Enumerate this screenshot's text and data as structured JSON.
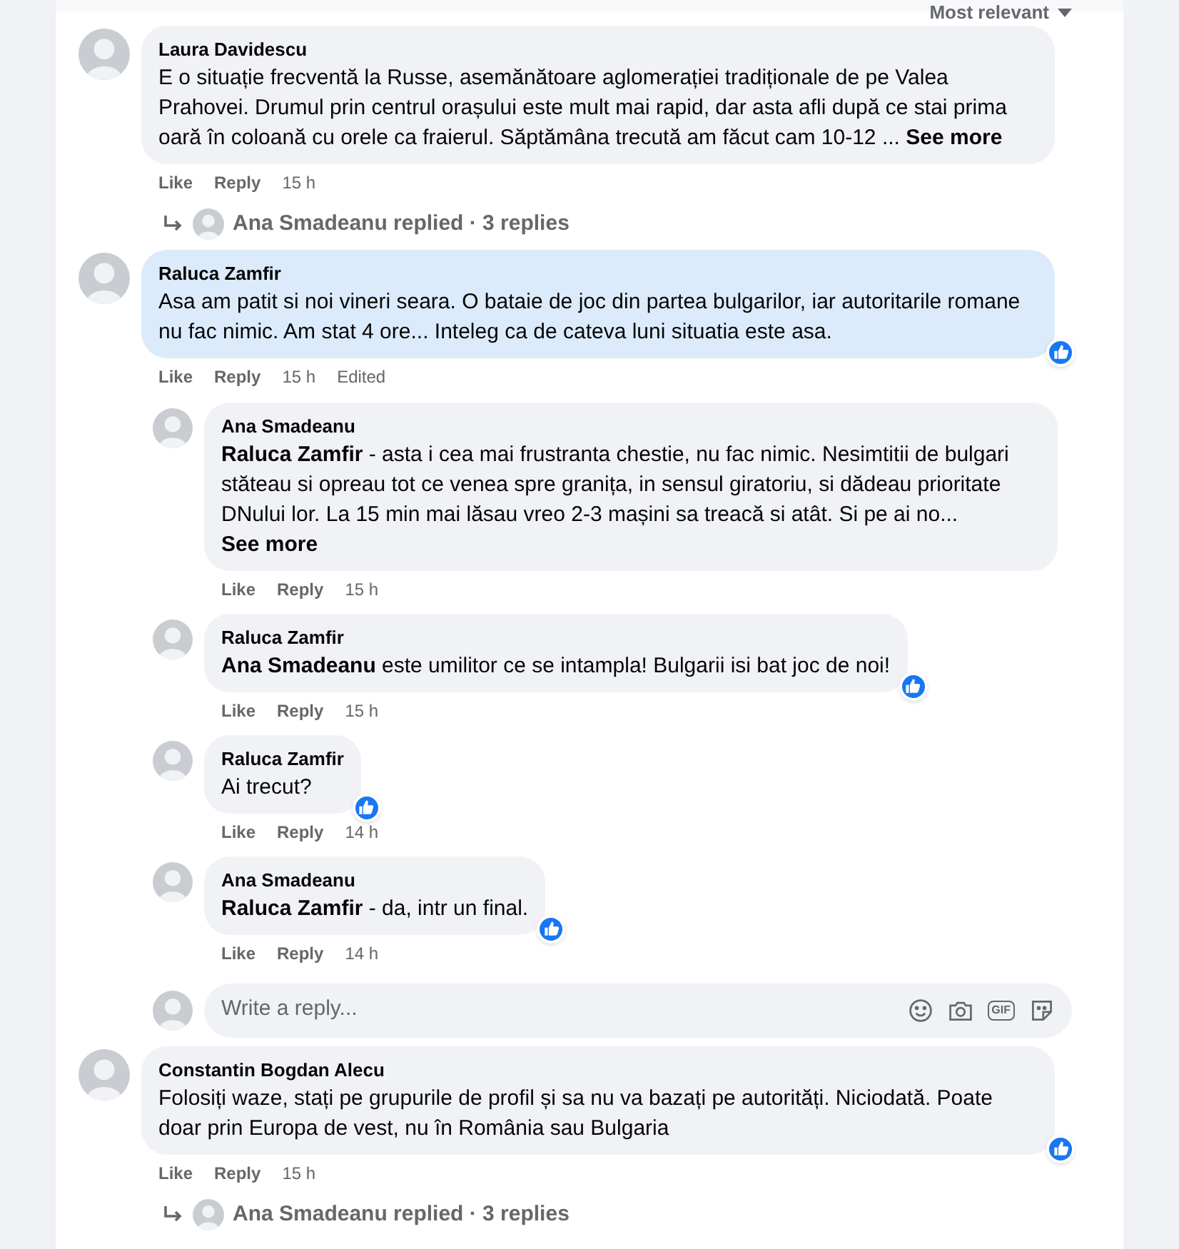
{
  "sort": {
    "label": "Most relevant"
  },
  "comments": [
    {
      "author": "Laura Davidescu",
      "text": "E o situație frecventă la Russe, asemănătoare aglomerației tradiționale de pe Valea Prahovei. Drumul prin centrul orașului este mult mai rapid, dar asta afli după ce stai prima oară în coloană cu orele ca fraierul. Săptămâna trecută am făcut cam 10-12 ...",
      "see_more": "See more",
      "highlighted": false,
      "reacted": false,
      "actions": [
        "Like",
        "Reply"
      ],
      "time": "15 h",
      "replies_summary": {
        "text": "Ana Smadeanu replied · 3 replies"
      }
    },
    {
      "author": "Raluca Zamfir",
      "text": "Asa am patit si noi vineri seara. O bataie de joc din partea bulgarilor, iar autoritarile romane nu fac nimic. Am stat 4 ore... Inteleg ca de cateva luni situatia este asa.",
      "highlighted": true,
      "reacted": true,
      "actions": [
        "Like",
        "Reply"
      ],
      "time": "15 h",
      "edited": "Edited",
      "replies": [
        {
          "author": "Ana Smadeanu",
          "text": "**Raluca Zamfir** - asta i cea mai frustranta chestie, nu fac nimic. Nesimtitii de bulgari stăteau si opreau tot ce venea spre granița, in sensul giratoriu, si dădeau prioritate DNului lor. La 15 min mai lăsau vreo 2-3 mașini sa treacă si atât. Si pe ai no...",
          "see_more": "See more",
          "highlighted": false,
          "reacted": false,
          "actions": [
            "Like",
            "Reply"
          ],
          "time": "15 h"
        },
        {
          "author": "Raluca Zamfir",
          "text": "**Ana Smadeanu** este umilitor ce se intampla! Bulgarii isi bat joc de noi!",
          "highlighted": false,
          "reacted": true,
          "actions": [
            "Like",
            "Reply"
          ],
          "time": "15 h"
        },
        {
          "author": "Raluca Zamfir",
          "text": "Ai trecut?",
          "highlighted": false,
          "reacted": true,
          "actions": [
            "Like",
            "Reply"
          ],
          "time": "14 h"
        },
        {
          "author": "Ana Smadeanu",
          "text": "**Raluca Zamfir** - da, intr un final.",
          "highlighted": false,
          "reacted": true,
          "actions": [
            "Like",
            "Reply"
          ],
          "time": "14 h"
        }
      ],
      "reply_box": {
        "placeholder": "Write a reply...",
        "gif_label": "GIF"
      }
    },
    {
      "author": "Constantin Bogdan Alecu",
      "text": "Folosiți waze, stați pe grupurile de profil și sa nu va bazați pe autorități. Niciodată. Poate doar prin Europa de vest, nu în România sau Bulgaria",
      "highlighted": false,
      "reacted": true,
      "actions": [
        "Like",
        "Reply"
      ],
      "time": "15 h",
      "replies_summary": {
        "text": "Ana Smadeanu replied · 3 replies"
      }
    }
  ]
}
